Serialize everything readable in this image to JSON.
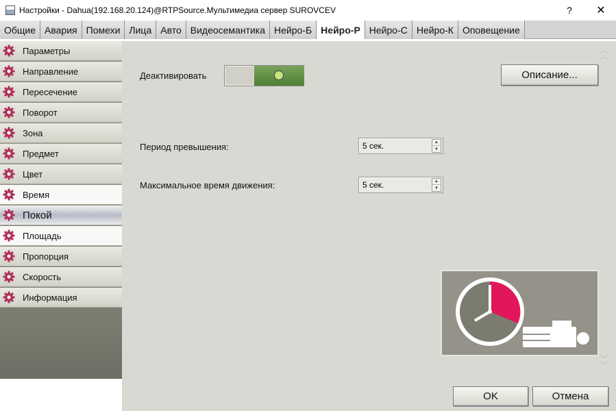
{
  "window": {
    "title": "Настройки - Dahua(192.168.20.124)@RTPSource.Мультимедиа сервер SUROVCEV",
    "help_label": "?",
    "close_label": "✕"
  },
  "tabs": [
    {
      "label": "Общие"
    },
    {
      "label": "Авария"
    },
    {
      "label": "Помехи"
    },
    {
      "label": "Лица"
    },
    {
      "label": "Авто"
    },
    {
      "label": "Видеосемантика"
    },
    {
      "label": "Нейро-Б"
    },
    {
      "label": "Нейро-Р",
      "active": true
    },
    {
      "label": "Нейро-С"
    },
    {
      "label": "Нейро-К"
    },
    {
      "label": "Оповещение"
    }
  ],
  "sidebar": {
    "items": [
      {
        "label": "Параметры"
      },
      {
        "label": "Направление"
      },
      {
        "label": "Пересечение"
      },
      {
        "label": "Поворот"
      },
      {
        "label": "Зона"
      },
      {
        "label": "Предмет"
      },
      {
        "label": "Цвет"
      },
      {
        "label": "Время"
      },
      {
        "label": "Покой",
        "active": true
      },
      {
        "label": "Площадь"
      },
      {
        "label": "Пропорция"
      },
      {
        "label": "Скорость"
      },
      {
        "label": "Информация"
      }
    ]
  },
  "main": {
    "deactivate_label": "Деактивировать",
    "toggle_state": "on",
    "description_button": "Описание...",
    "period_label": "Период превышения:",
    "period_value": "5 сек.",
    "max_time_label": "Максимальное время движения:",
    "max_time_value": "5 сек.",
    "ok_button": "OK",
    "cancel_button": "Отмена"
  },
  "colors": {
    "gear": "#b0305a",
    "toggle_on": "#5e8a3e",
    "clock_slice": "#e0185a",
    "illustration_bg": "#949289"
  },
  "icons": {
    "gear": "gear-icon",
    "clock": "clock-icon",
    "person": "lying-person-icon"
  }
}
